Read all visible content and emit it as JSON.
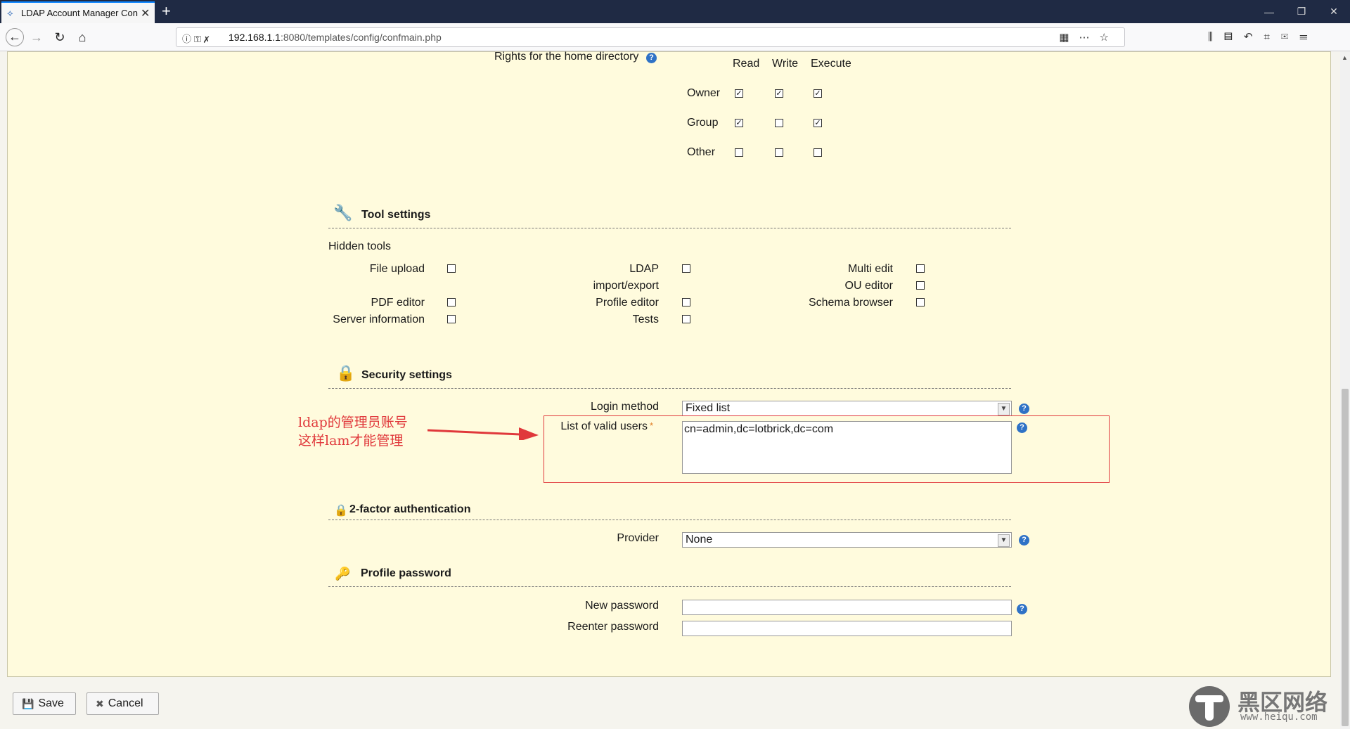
{
  "browser": {
    "tab_title": "LDAP Account Manager Con",
    "url_host": "192.168.1.1",
    "url_path": ":8080/templates/config/confmain.php"
  },
  "home_dir": {
    "label": "Rights for the home directory",
    "columns": [
      "Read",
      "Write",
      "Execute"
    ],
    "rows": [
      {
        "label": "Owner",
        "checks": [
          true,
          true,
          true
        ]
      },
      {
        "label": "Group",
        "checks": [
          true,
          false,
          true
        ]
      },
      {
        "label": "Other",
        "checks": [
          false,
          false,
          false
        ]
      }
    ]
  },
  "tool_settings": {
    "title": "Tool settings",
    "hidden_label": "Hidden tools",
    "items": [
      {
        "label": "File upload",
        "checked": false
      },
      {
        "label": "LDAP",
        "label2": "import/export",
        "checked": false
      },
      {
        "label": "Multi edit",
        "checked": false
      },
      {
        "label": "OU editor",
        "checked": false
      },
      {
        "label": "PDF editor",
        "checked": false
      },
      {
        "label": "Profile editor",
        "checked": false
      },
      {
        "label": "Schema browser",
        "checked": false
      },
      {
        "label": "Server information",
        "checked": false
      },
      {
        "label": "Tests",
        "checked": false
      }
    ]
  },
  "security": {
    "title": "Security settings",
    "login_label": "Login method",
    "login_value": "Fixed list",
    "users_label": "List of valid users",
    "required_mark": "*",
    "users_value": "cn=admin,dc=lotbrick,dc=com"
  },
  "annotation": {
    "line1": "ldap的管理员账号",
    "line2": "这样lam才能管理"
  },
  "twofactor": {
    "title": "2-factor authentication",
    "provider_label": "Provider",
    "provider_value": "None"
  },
  "profile_password": {
    "title": "Profile password",
    "new_label": "New password",
    "reenter_label": "Reenter password"
  },
  "buttons": {
    "save": "Save",
    "cancel": "Cancel"
  },
  "watermark": {
    "text": "黑区网络",
    "url": "www.heiqu.com"
  }
}
